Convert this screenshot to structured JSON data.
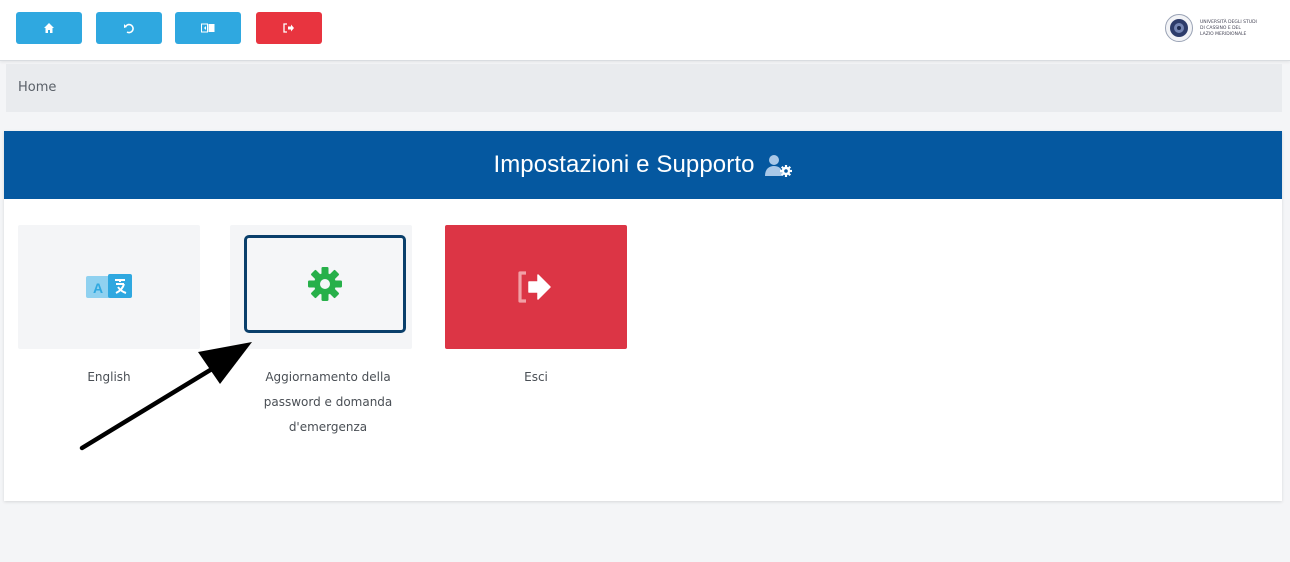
{
  "toolbar": {
    "buttons": [
      {
        "name": "home",
        "icon": "home-icon",
        "color": "#2fa8e0"
      },
      {
        "name": "back",
        "icon": "undo-icon",
        "color": "#2fa8e0"
      },
      {
        "name": "screen",
        "icon": "display-icon",
        "color": "#2fa8e0"
      },
      {
        "name": "logout",
        "icon": "sign-out-icon",
        "color": "#e8343f"
      }
    ],
    "logo": {
      "icon": "university-seal-icon",
      "lines": [
        "UNIVERSITÀ DEGLI STUDI",
        "DI CASSINO E DEL",
        "LAZIO MERIDIONALE"
      ]
    }
  },
  "breadcrumb": {
    "label": "Home"
  },
  "card": {
    "title": "Impostazioni e Supporto",
    "title_icon": "user-gear-icon",
    "header_color": "#0558a0"
  },
  "tiles": [
    {
      "label": "English",
      "icon": "language-icon"
    },
    {
      "label_lines": [
        "Aggiornamento della",
        "password e domanda",
        "d'emergenza"
      ],
      "icon": "gear-icon",
      "icon_color": "#27b04a"
    },
    {
      "label": "Esci",
      "icon": "sign-out-icon",
      "color": "#dc3545"
    }
  ]
}
